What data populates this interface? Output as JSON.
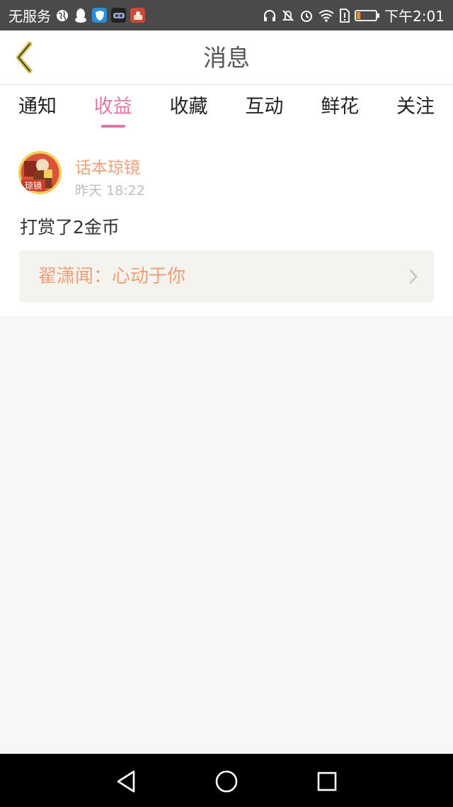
{
  "status_bar": {
    "carrier": "无服务",
    "time": "下午2:01",
    "icons": [
      "globe-icon",
      "qq-penguin-icon",
      "shield-app-icon",
      "game-app-icon",
      "cake-app-icon",
      "headphones-icon",
      "mute-icon",
      "alarm-icon",
      "wifi-icon",
      "sim-alert-icon",
      "battery-icon"
    ],
    "battery_level": 0.2
  },
  "header": {
    "title": "消息",
    "back_icon": "chevron-left-icon",
    "accent": "#d9c85a"
  },
  "tabs": [
    {
      "label": "通知",
      "active": false
    },
    {
      "label": "收益",
      "active": true
    },
    {
      "label": "收藏",
      "active": false
    },
    {
      "label": "互动",
      "active": false
    },
    {
      "label": "鲜花",
      "active": false
    },
    {
      "label": "关注",
      "active": false
    }
  ],
  "colors": {
    "tab_active": "#dd78a9",
    "sender_name": "#eaa07a",
    "background": "#f8f6f6"
  },
  "message": {
    "sender_name": "话本琼镜",
    "avatar_badge": "琼镜",
    "time": "昨天 18:22",
    "text": "打赏了2金币",
    "reference": "翟潇闻：心动于你"
  },
  "nav_bar": {
    "buttons": [
      "back-triangle-icon",
      "home-circle-icon",
      "recents-square-icon"
    ]
  }
}
